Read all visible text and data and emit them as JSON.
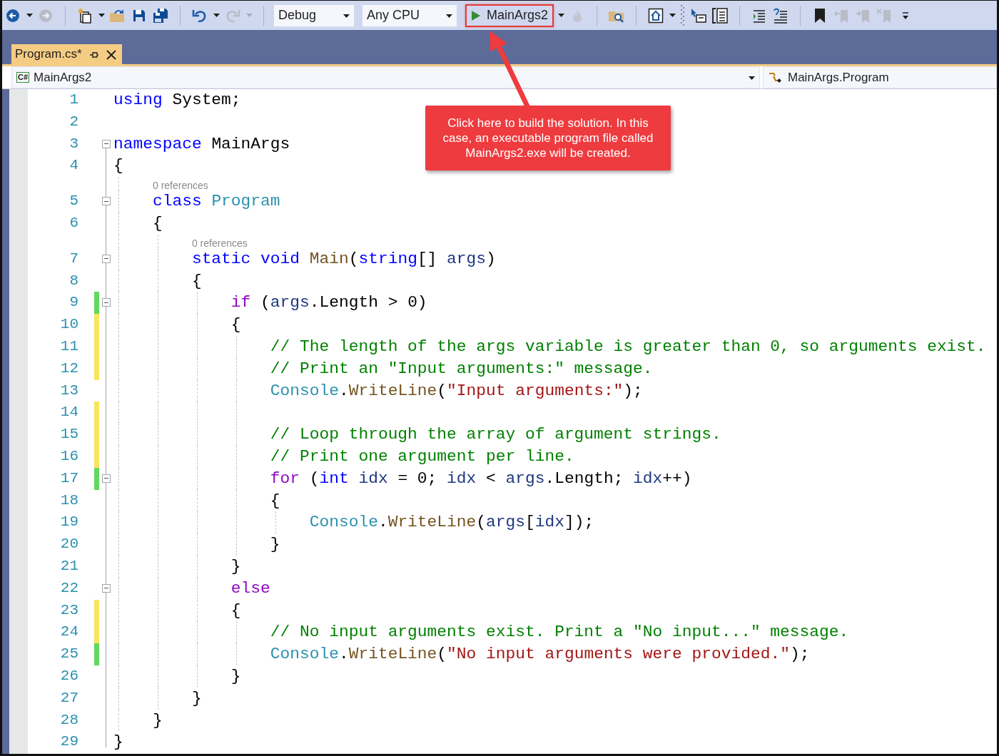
{
  "toolbar": [
    {
      "kind": "back",
      "disabled": false
    },
    {
      "kind": "caret",
      "disabled": false
    },
    {
      "kind": "forward",
      "disabled": true
    },
    {
      "kind": "separator"
    },
    {
      "kind": "newproject",
      "disabled": false
    },
    {
      "kind": "caret",
      "disabled": false
    },
    {
      "kind": "open",
      "disabled": false
    },
    {
      "kind": "save",
      "disabled": false
    },
    {
      "kind": "saveall",
      "disabled": false
    },
    {
      "kind": "separator"
    },
    {
      "kind": "undo",
      "disabled": false
    },
    {
      "kind": "caret",
      "disabled": false
    },
    {
      "kind": "redo",
      "disabled": true
    },
    {
      "kind": "caret",
      "disabled": true
    },
    {
      "kind": "separator"
    },
    {
      "kind": "combo",
      "value": "Debug",
      "disabled": false
    },
    {
      "kind": "combo",
      "value": "Any CPU",
      "disabled": false
    },
    {
      "kind": "start",
      "label": "MainArgs2",
      "highlighted": true,
      "disabled": false
    },
    {
      "kind": "caret",
      "disabled": false
    },
    {
      "kind": "hotreload",
      "disabled": true
    },
    {
      "kind": "separator"
    },
    {
      "kind": "findfolder",
      "disabled": false
    },
    {
      "kind": "separator"
    },
    {
      "kind": "home",
      "disabled": false
    },
    {
      "kind": "caret",
      "disabled": false
    },
    {
      "kind": "gripper"
    },
    {
      "kind": "pointer",
      "disabled": false
    },
    {
      "kind": "split",
      "disabled": false
    },
    {
      "kind": "separator"
    },
    {
      "kind": "indent",
      "disabled": false
    },
    {
      "kind": "uncomment",
      "disabled": false
    },
    {
      "kind": "separator"
    },
    {
      "kind": "bookmark",
      "disabled": false
    },
    {
      "kind": "bookmarkprev",
      "disabled": true
    },
    {
      "kind": "bookmarknext",
      "disabled": true
    },
    {
      "kind": "bookmarkclear",
      "disabled": true
    },
    {
      "kind": "overflow"
    }
  ],
  "tabs": [
    {
      "label": "Program.cs*",
      "selected": true
    }
  ],
  "navigation": {
    "project_icon_text": "C#",
    "project": "MainArgs2",
    "type": "MainArgs.Program"
  },
  "code_lines": [
    {
      "number": "1",
      "tokens": [
        {
          "kind": "keyword",
          "text": "using"
        },
        {
          "kind": "plain",
          "text": " System;"
        }
      ]
    },
    {
      "number": "2"
    },
    {
      "number": "3",
      "foldable": true,
      "tokens": [
        {
          "kind": "keyword",
          "text": "namespace"
        },
        {
          "kind": "plain",
          "text": " MainArgs"
        }
      ]
    },
    {
      "number": "4",
      "tokens": [
        {
          "kind": "plain",
          "text": "{"
        }
      ]
    },
    {
      "number": "5",
      "references": "0 references",
      "foldable": true,
      "tokens": [
        {
          "kind": "keyword",
          "text": "    class"
        },
        {
          "kind": "type",
          "text": " Program"
        }
      ]
    },
    {
      "number": "6",
      "tokens": [
        {
          "kind": "plain",
          "text": "    {"
        }
      ]
    },
    {
      "number": "7",
      "references": "0 references",
      "foldable": true,
      "tokens": [
        {
          "kind": "keyword",
          "text": "        static"
        },
        {
          "kind": "keyword",
          "text": " void"
        },
        {
          "kind": "method",
          "text": " Main"
        },
        {
          "kind": "plain",
          "text": "("
        },
        {
          "kind": "keyword",
          "text": "string"
        },
        {
          "kind": "plain",
          "text": "[] "
        },
        {
          "kind": "variable",
          "text": "args"
        },
        {
          "kind": "plain",
          "text": ")"
        }
      ]
    },
    {
      "number": "8",
      "tokens": [
        {
          "kind": "plain",
          "text": "        {"
        }
      ]
    },
    {
      "number": "9",
      "modified": true,
      "saved": true,
      "foldable": true,
      "tokens": [
        {
          "kind": "control",
          "text": "            if"
        },
        {
          "kind": "plain",
          "text": " ("
        },
        {
          "kind": "variable",
          "text": "args"
        },
        {
          "kind": "plain",
          "text": ".Length > 0)"
        }
      ]
    },
    {
      "number": "10",
      "modified": true,
      "saved": false,
      "tokens": [
        {
          "kind": "plain",
          "text": "            {"
        }
      ]
    },
    {
      "number": "11",
      "modified": true,
      "saved": false,
      "tokens": [
        {
          "kind": "comment",
          "text": "                // The length of the args variable is greater than 0, so arguments exist."
        }
      ]
    },
    {
      "number": "12",
      "modified": true,
      "saved": false,
      "tokens": [
        {
          "kind": "comment",
          "text": "                // Print an \"Input arguments:\" message."
        }
      ]
    },
    {
      "number": "13",
      "tokens": [
        {
          "kind": "type",
          "text": "                Console"
        },
        {
          "kind": "plain",
          "text": "."
        },
        {
          "kind": "method",
          "text": "WriteLine"
        },
        {
          "kind": "plain",
          "text": "("
        },
        {
          "kind": "string",
          "text": "\"Input arguments:\""
        },
        {
          "kind": "plain",
          "text": ");"
        }
      ]
    },
    {
      "number": "14",
      "modified": true,
      "saved": false
    },
    {
      "number": "15",
      "modified": true,
      "saved": false,
      "tokens": [
        {
          "kind": "comment",
          "text": "                // Loop through the array of argument strings."
        }
      ]
    },
    {
      "number": "16",
      "modified": true,
      "saved": false,
      "tokens": [
        {
          "kind": "comment",
          "text": "                // Print one argument per line."
        }
      ]
    },
    {
      "number": "17",
      "modified": true,
      "saved": true,
      "foldable": true,
      "tokens": [
        {
          "kind": "control",
          "text": "                for"
        },
        {
          "kind": "plain",
          "text": " ("
        },
        {
          "kind": "keyword",
          "text": "int"
        },
        {
          "kind": "variable",
          "text": " idx"
        },
        {
          "kind": "plain",
          "text": " = 0; "
        },
        {
          "kind": "variable",
          "text": "idx"
        },
        {
          "kind": "plain",
          "text": " < "
        },
        {
          "kind": "variable",
          "text": "args"
        },
        {
          "kind": "plain",
          "text": ".Length; "
        },
        {
          "kind": "variable",
          "text": "idx"
        },
        {
          "kind": "plain",
          "text": "++)"
        }
      ]
    },
    {
      "number": "18",
      "tokens": [
        {
          "kind": "plain",
          "text": "                {"
        }
      ]
    },
    {
      "number": "19",
      "tokens": [
        {
          "kind": "type",
          "text": "                    Console"
        },
        {
          "kind": "plain",
          "text": "."
        },
        {
          "kind": "method",
          "text": "WriteLine"
        },
        {
          "kind": "plain",
          "text": "("
        },
        {
          "kind": "variable",
          "text": "args"
        },
        {
          "kind": "plain",
          "text": "["
        },
        {
          "kind": "variable",
          "text": "idx"
        },
        {
          "kind": "plain",
          "text": "]);"
        }
      ]
    },
    {
      "number": "20",
      "tokens": [
        {
          "kind": "plain",
          "text": "                }"
        }
      ]
    },
    {
      "number": "21",
      "tokens": [
        {
          "kind": "plain",
          "text": "            }"
        }
      ]
    },
    {
      "number": "22",
      "foldable": true,
      "tokens": [
        {
          "kind": "control",
          "text": "            else"
        }
      ]
    },
    {
      "number": "23",
      "modified": true,
      "saved": false,
      "tokens": [
        {
          "kind": "plain",
          "text": "            {"
        }
      ]
    },
    {
      "number": "24",
      "modified": true,
      "saved": false,
      "tokens": [
        {
          "kind": "comment",
          "text": "                // No input arguments exist. Print a \"No input...\" message."
        }
      ]
    },
    {
      "number": "25",
      "modified": true,
      "saved": true,
      "tokens": [
        {
          "kind": "type",
          "text": "                Console"
        },
        {
          "kind": "plain",
          "text": "."
        },
        {
          "kind": "method",
          "text": "WriteLine"
        },
        {
          "kind": "plain",
          "text": "("
        },
        {
          "kind": "string",
          "text": "\"No input arguments were provided.\""
        },
        {
          "kind": "plain",
          "text": ");"
        }
      ]
    },
    {
      "number": "26",
      "tokens": [
        {
          "kind": "plain",
          "text": "            }"
        }
      ]
    },
    {
      "number": "27",
      "tokens": [
        {
          "kind": "plain",
          "text": "        }"
        }
      ]
    },
    {
      "number": "28",
      "tokens": [
        {
          "kind": "plain",
          "text": "    }"
        }
      ]
    },
    {
      "number": "29",
      "tokens": [
        {
          "kind": "plain",
          "text": "}"
        }
      ]
    }
  ],
  "callout": {
    "text": "Click here to build the solution. In this case, an executable program file called MainArgs2.exe will be created."
  }
}
